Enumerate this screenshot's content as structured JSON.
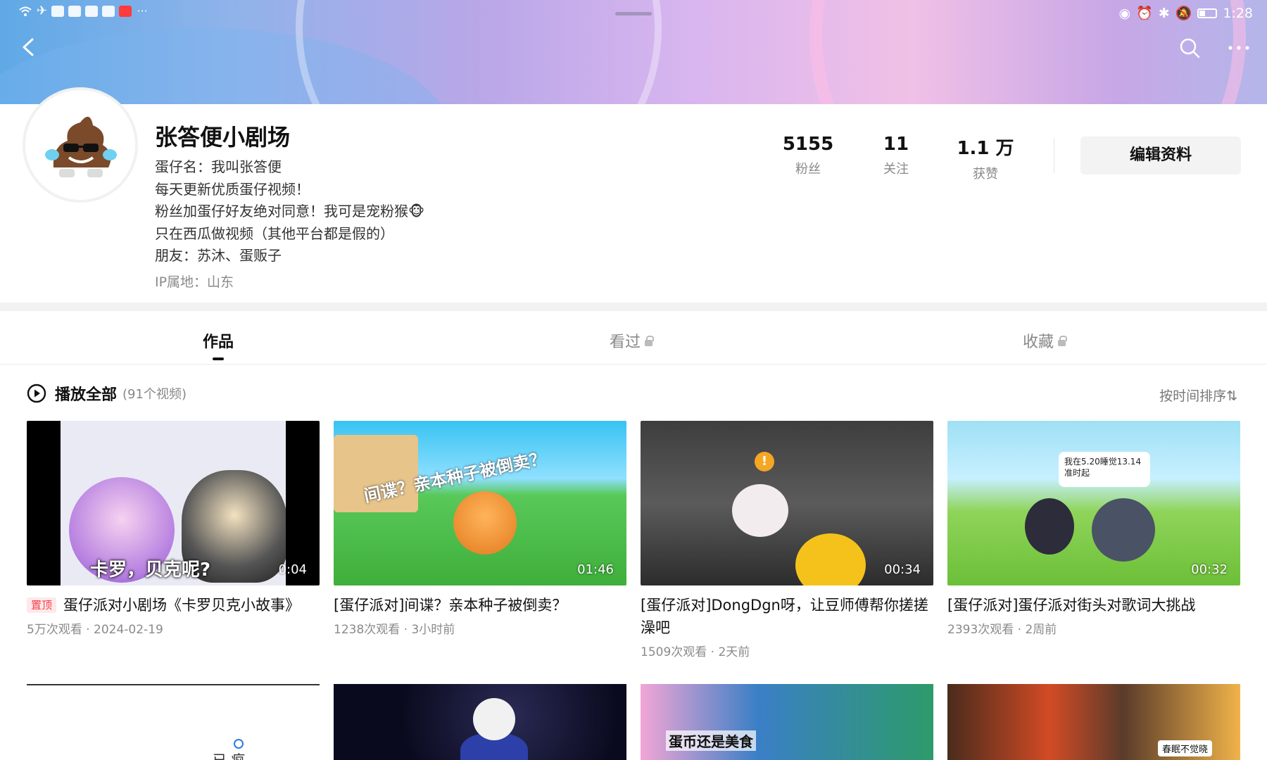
{
  "status_bar": {
    "time": "1:28",
    "more_glyph": "···",
    "battery_fill": 0.35
  },
  "profile": {
    "name": "张答便小剧场",
    "bio_lines": [
      "蛋仔名：我叫张答便",
      "每天更新优质蛋仔视频！",
      "粉丝加蛋仔好友绝对同意！我可是宠粉猴🐵",
      "只在西瓜做视频（其他平台都是假的）",
      "朋友：苏沐、蛋贩子"
    ],
    "ip_location": "IP属地：山东"
  },
  "stats": [
    {
      "value": "5155",
      "label": "粉丝"
    },
    {
      "value": "11",
      "label": "关注"
    },
    {
      "value": "1.1 万",
      "label": "获赞"
    }
  ],
  "edit_profile_label": "编辑资料",
  "tabs": [
    {
      "label": "作品",
      "active": true,
      "locked": false
    },
    {
      "label": "看过",
      "active": false,
      "locked": true
    },
    {
      "label": "收藏",
      "active": false,
      "locked": true
    }
  ],
  "play_all": {
    "label": "播放全部",
    "count": "(91个视频)"
  },
  "sort_label": "按时间排序⇅",
  "videos": [
    {
      "title": "蛋仔派对小剧场《卡罗贝克小故事》",
      "pinned_label": "置顶",
      "duration": "0:04",
      "caption": "卡罗，贝克呢?",
      "meta": "5万次观看 · 2024-02-19"
    },
    {
      "title": "[蛋仔派对]间谍？亲本种子被倒卖？",
      "duration": "01:46",
      "caption": "间谍？亲本种子被倒卖？",
      "meta": "1238次观看 · 3小时前"
    },
    {
      "title": "[蛋仔派对]DongDgn呀，让豆师傅帮你搓搓澡吧",
      "duration": "00:34",
      "caption": "!",
      "meta": "1509次观看 · 2天前"
    },
    {
      "title": "[蛋仔派对]蛋仔派对街头对歌词大挑战",
      "duration": "00:32",
      "caption": "我在5.20睡觉13.14准时起",
      "meta": "2393次观看 · 2周前"
    }
  ],
  "row2_captions": [
    "已 疯",
    "蛋币还是美食",
    "春眠不觉晓"
  ],
  "colors": {
    "accent_pin": "#f2414b",
    "banner_start": "#5fa9e6",
    "banner_end": "#b4b6ea"
  },
  "icons": {
    "back": "back-arrow-icon",
    "search": "search-icon",
    "more": "more-dots-icon",
    "play": "play-circle-icon",
    "lock": "lock-icon"
  }
}
